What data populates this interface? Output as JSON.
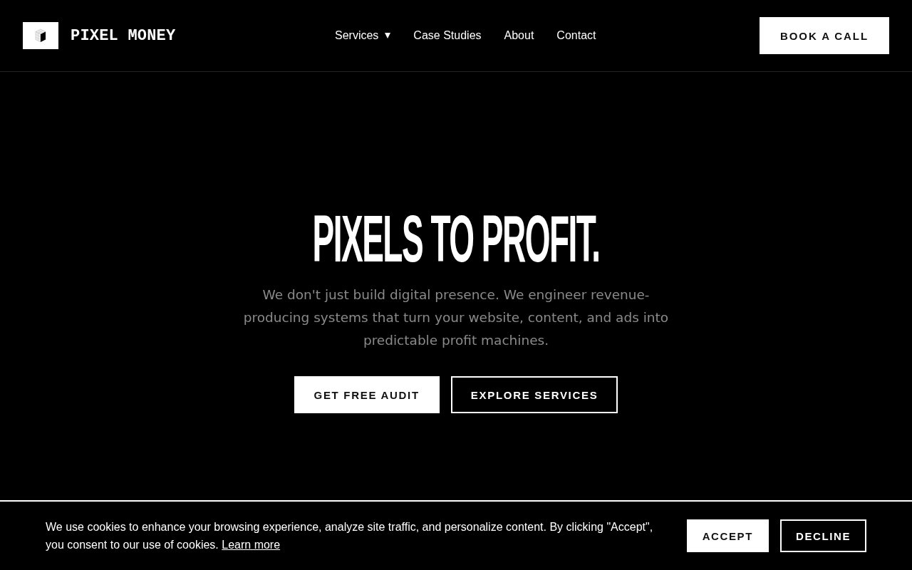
{
  "header": {
    "logo": {
      "text": "PIXEL MONEY"
    },
    "nav": [
      {
        "label": "Services",
        "dropdown": true
      },
      {
        "label": "Case Studies",
        "dropdown": false
      },
      {
        "label": "About",
        "dropdown": false
      },
      {
        "label": "Contact",
        "dropdown": false
      }
    ],
    "cta": {
      "label": "BOOK A CALL",
      "kind": "solid"
    }
  },
  "hero": {
    "headline": "PIXELS TO PROFIT.",
    "subtitle": "We don't just build digital presence. We engineer revenue-producing systems that turn your website, content, and ads into predictable profit machines.",
    "buttons": [
      {
        "label": "GET FREE AUDIT",
        "kind": "solid"
      },
      {
        "label": "EXPLORE SERVICES",
        "kind": "outline"
      }
    ]
  },
  "cookie_banner": {
    "text": "We use cookies to enhance your browsing experience, analyze site traffic, and personalize content. By clicking \"Accept\", you consent to our use of cookies.",
    "link": "Learn more",
    "buttons": [
      {
        "label": "ACCEPT",
        "kind": "solid"
      },
      {
        "label": "DECLINE",
        "kind": "outline"
      }
    ]
  }
}
